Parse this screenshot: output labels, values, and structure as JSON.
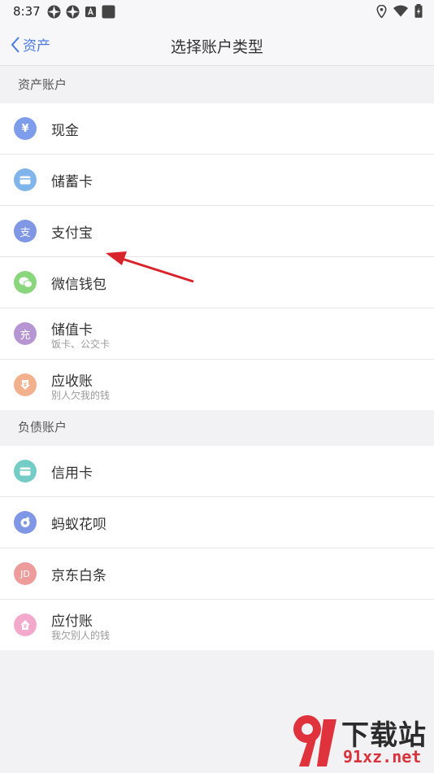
{
  "status_bar": {
    "time": "8:37"
  },
  "nav": {
    "back_label": "资产",
    "title": "选择账户类型"
  },
  "sections": [
    {
      "header": "资产账户",
      "items": [
        {
          "title": "现金",
          "subtitle": "",
          "icon": "yen-icon",
          "glyph": "¥",
          "color": "#7d9cea"
        },
        {
          "title": "储蓄卡",
          "subtitle": "",
          "icon": "card-icon",
          "glyph": "",
          "color": "#7fb5ea"
        },
        {
          "title": "支付宝",
          "subtitle": "",
          "icon": "alipay-icon",
          "glyph": "支",
          "color": "#7f97e4"
        },
        {
          "title": "微信钱包",
          "subtitle": "",
          "icon": "wechat-icon",
          "glyph": "",
          "color": "#8ad67d"
        },
        {
          "title": "储值卡",
          "subtitle": "饭卡、公交卡",
          "icon": "recharge-icon",
          "glyph": "充",
          "color": "#b696d2"
        },
        {
          "title": "应收账",
          "subtitle": "别人欠我的钱",
          "icon": "receivable-icon",
          "glyph": "",
          "color": "#f3b08c"
        }
      ]
    },
    {
      "header": "负债账户",
      "items": [
        {
          "title": "信用卡",
          "subtitle": "",
          "icon": "credit-card-icon",
          "glyph": "",
          "color": "#74ccc6"
        },
        {
          "title": "蚂蚁花呗",
          "subtitle": "",
          "icon": "huabei-icon",
          "glyph": "",
          "color": "#7f97e4"
        },
        {
          "title": "京东白条",
          "subtitle": "",
          "icon": "jd-icon",
          "glyph": "JD",
          "color": "#ee9b9b"
        },
        {
          "title": "应付账",
          "subtitle": "我欠别人的钱",
          "icon": "payable-icon",
          "glyph": "",
          "color": "#f2a9cc"
        }
      ]
    }
  ],
  "watermark": {
    "brand": "下载站",
    "domain": "91xz.net"
  }
}
